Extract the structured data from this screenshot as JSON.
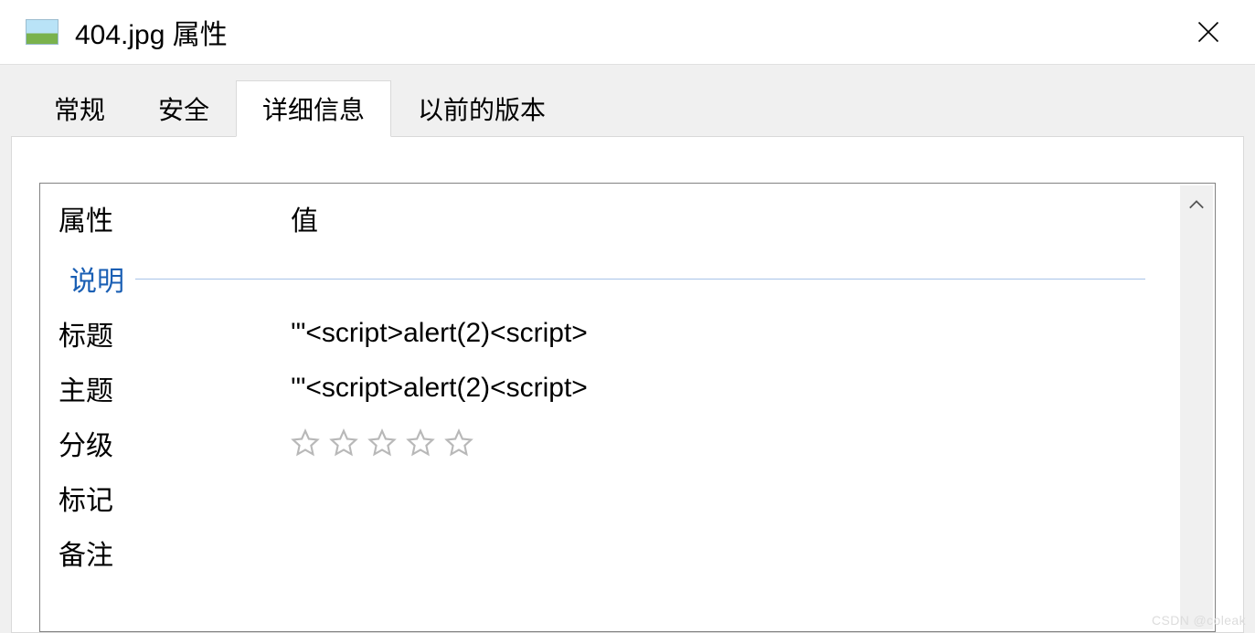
{
  "window": {
    "title": "404.jpg 属性"
  },
  "tabs": {
    "general": "常规",
    "security": "安全",
    "details": "详细信息",
    "previous_versions": "以前的版本"
  },
  "details": {
    "header_prop": "属性",
    "header_val": "值",
    "section_description": "说明",
    "rows": {
      "title": {
        "label": "标题",
        "value": "'\"<script>alert(2)<script>"
      },
      "subject": {
        "label": "主题",
        "value": "'\"<script>alert(2)<script>"
      },
      "rating": {
        "label": "分级",
        "value": ""
      },
      "tags": {
        "label": "标记",
        "value": ""
      },
      "comments": {
        "label": "备注",
        "value": ""
      }
    }
  },
  "watermark": "CSDN @coleak"
}
